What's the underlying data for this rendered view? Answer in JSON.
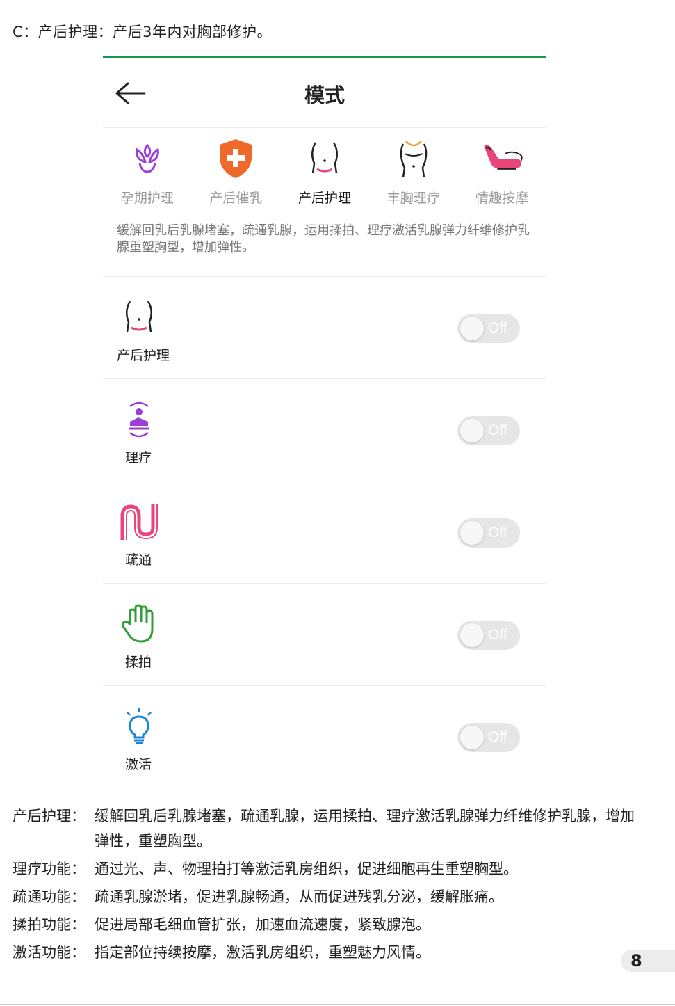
{
  "intro": "C：产后护理：产后3年内对胸部修护。",
  "screen": {
    "title": "模式",
    "tabs": [
      {
        "label": "孕期护理",
        "icon": "pregnancy-care-icon",
        "active": false
      },
      {
        "label": "产后催乳",
        "icon": "lactation-shield-icon",
        "active": false
      },
      {
        "label": "产后护理",
        "icon": "postpartum-care-icon",
        "active": true
      },
      {
        "label": "丰胸理疗",
        "icon": "breast-enhancement-icon",
        "active": false
      },
      {
        "label": "情趣按摩",
        "icon": "massage-chair-icon",
        "active": false
      }
    ],
    "description": "缓解回乳后乳腺堵塞，疏通乳腺，运用揉拍、理疗激活乳腺弹力纤维修护乳腺重塑胸型，增加弹性。",
    "rows": [
      {
        "label": "产后护理",
        "toggle": "Off",
        "icon": "postpartum-care-icon"
      },
      {
        "label": "理疗",
        "toggle": "Off",
        "icon": "therapy-icon"
      },
      {
        "label": "疏通",
        "toggle": "Off",
        "icon": "unblock-icon"
      },
      {
        "label": "揉拍",
        "toggle": "Off",
        "icon": "hand-icon"
      },
      {
        "label": "激活",
        "toggle": "Off",
        "icon": "lightbulb-icon"
      }
    ]
  },
  "explanations": [
    {
      "key": "产后护理：",
      "value": "缓解回乳后乳腺堵塞，疏通乳腺，运用揉拍、理疗激活乳腺弹力纤维修护乳腺，增加弹性，重塑胸型。"
    },
    {
      "key": "理疗功能：",
      "value": "通过光、声、物理拍打等激活乳房组织，促进细胞再生重塑胸型。"
    },
    {
      "key": "疏通功能：",
      "value": " 疏通乳腺淤堵，促进乳腺畅通，从而促进残乳分泌，缓解胀痛。"
    },
    {
      "key": "揉拍功能：",
      "value": "促进局部毛细血管扩张，加速血流速度，紧致腺泡。"
    },
    {
      "key": "激活功能：",
      "value": "指定部位持续按摩，激活乳房组织，重塑魅力风情。"
    }
  ],
  "page_number": "8",
  "colors": {
    "accent_green": "#119a4a",
    "purple": "#9b3fd6",
    "orange": "#ef6a2a",
    "pink": "#e8457a",
    "green": "#2f9e34",
    "blue": "#1a86d8"
  }
}
